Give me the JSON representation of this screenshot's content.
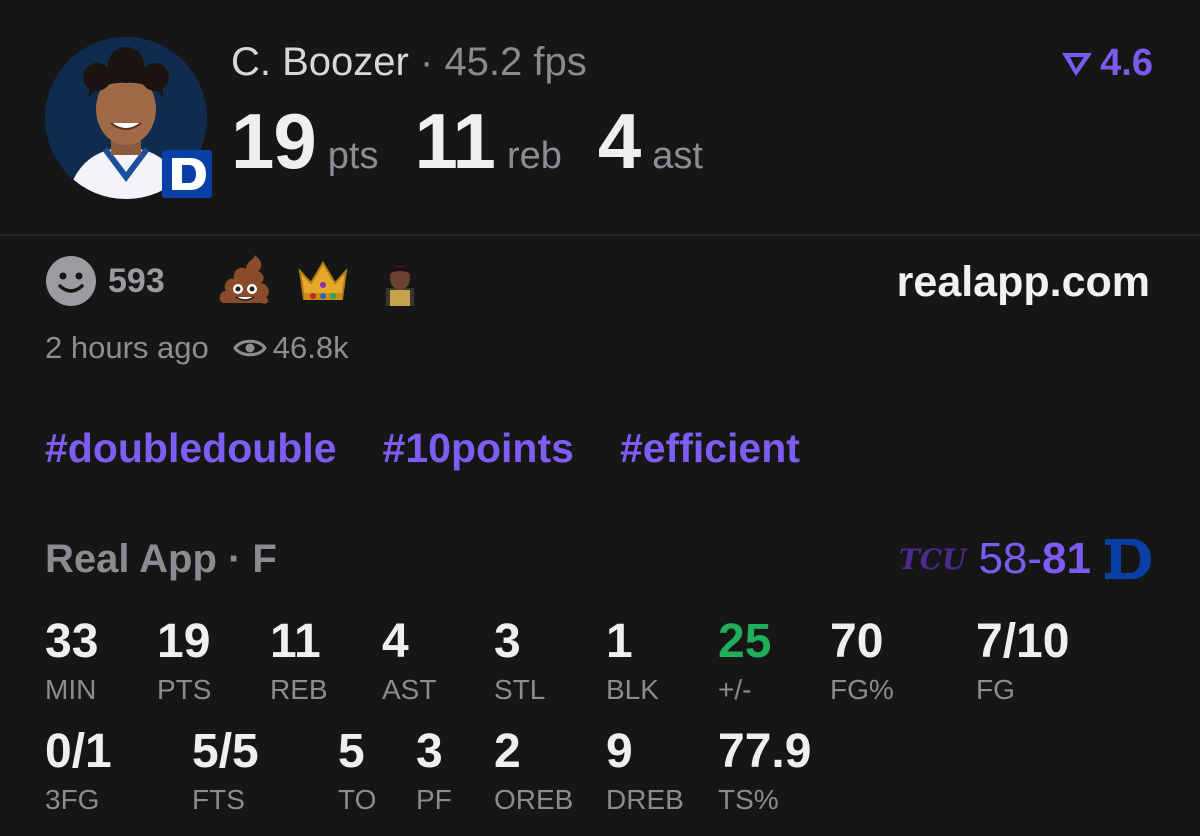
{
  "player": {
    "name": "C. Boozer",
    "separator": "·",
    "fps": "45.2 fps",
    "rating": "4.6",
    "stats": [
      {
        "value": "19",
        "unit": "pts"
      },
      {
        "value": "11",
        "unit": "reb"
      },
      {
        "value": "4",
        "unit": "ast"
      }
    ]
  },
  "reactions": {
    "count": "593",
    "emojis": [
      "pile-of-poo-emoji",
      "crown-emoji",
      "player-emoji"
    ],
    "time": "2 hours ago",
    "views": "46.8k"
  },
  "site": "realapp.com",
  "tags": [
    "#doubledouble",
    "#10points",
    "#efficient"
  ],
  "game": {
    "league": "Real App · F",
    "away_logo": "TCU",
    "away_score": "58",
    "dash": "-",
    "home_score": "81"
  },
  "box": {
    "row1": [
      {
        "value": "33",
        "label": "MIN"
      },
      {
        "value": "19",
        "label": "PTS"
      },
      {
        "value": "11",
        "label": "REB"
      },
      {
        "value": "4",
        "label": "AST"
      },
      {
        "value": "3",
        "label": "STL"
      },
      {
        "value": "1",
        "label": "BLK"
      },
      {
        "value": "25",
        "label": "+/-"
      },
      {
        "value": "70",
        "label": "FG%"
      },
      {
        "value": "7/10",
        "label": "FG"
      }
    ],
    "row2": [
      {
        "value": "0/1",
        "label": "3FG"
      },
      {
        "value": "5/5",
        "label": "FTS"
      },
      {
        "value": "5",
        "label": "TO"
      },
      {
        "value": "3",
        "label": "PF"
      },
      {
        "value": "2",
        "label": "OREB"
      },
      {
        "value": "9",
        "label": "DREB"
      },
      {
        "value": "77.9",
        "label": "TS%"
      }
    ]
  },
  "colors": {
    "accent": "#7a5cf0",
    "positive": "#1fae5a",
    "background": "#161617"
  }
}
